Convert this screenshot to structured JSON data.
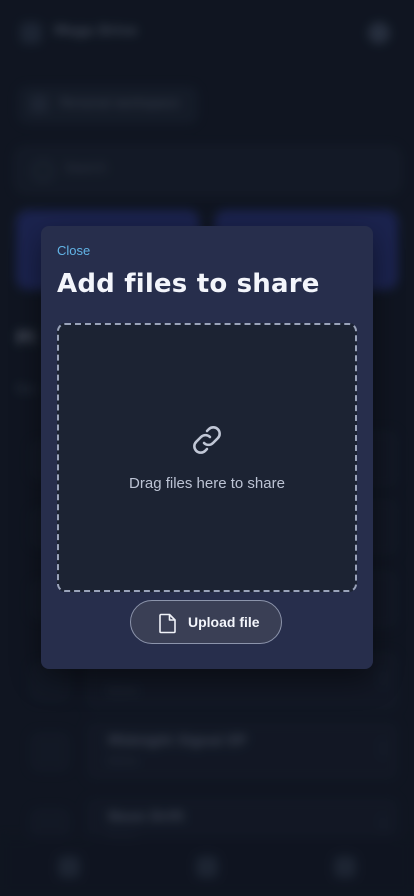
{
  "background": {
    "app_title": "Mega Drive",
    "chip_label": "Personal workspace",
    "search_placeholder": "Search",
    "section_title": "Pl",
    "section_sub": "Rec",
    "rows": [
      {
        "name": "",
        "meta": ""
      },
      {
        "name": "",
        "meta": ""
      },
      {
        "name": "",
        "meta": ""
      },
      {
        "name": "",
        "meta": "Demo"
      },
      {
        "name": "Midnight Signal EP",
        "meta": "Demo"
      },
      {
        "name": "Neon Drift",
        "meta": "Demo"
      }
    ]
  },
  "modal": {
    "close_label": "Close",
    "title": "Add files to share",
    "dropzone_text": "Drag files here to share",
    "upload_label": "Upload file",
    "link_icon": "link-icon",
    "file_icon": "file-icon"
  },
  "colors": {
    "accent_link": "#62b4e6",
    "modal_bg": "#272e4c",
    "page_bg": "#141a27"
  }
}
